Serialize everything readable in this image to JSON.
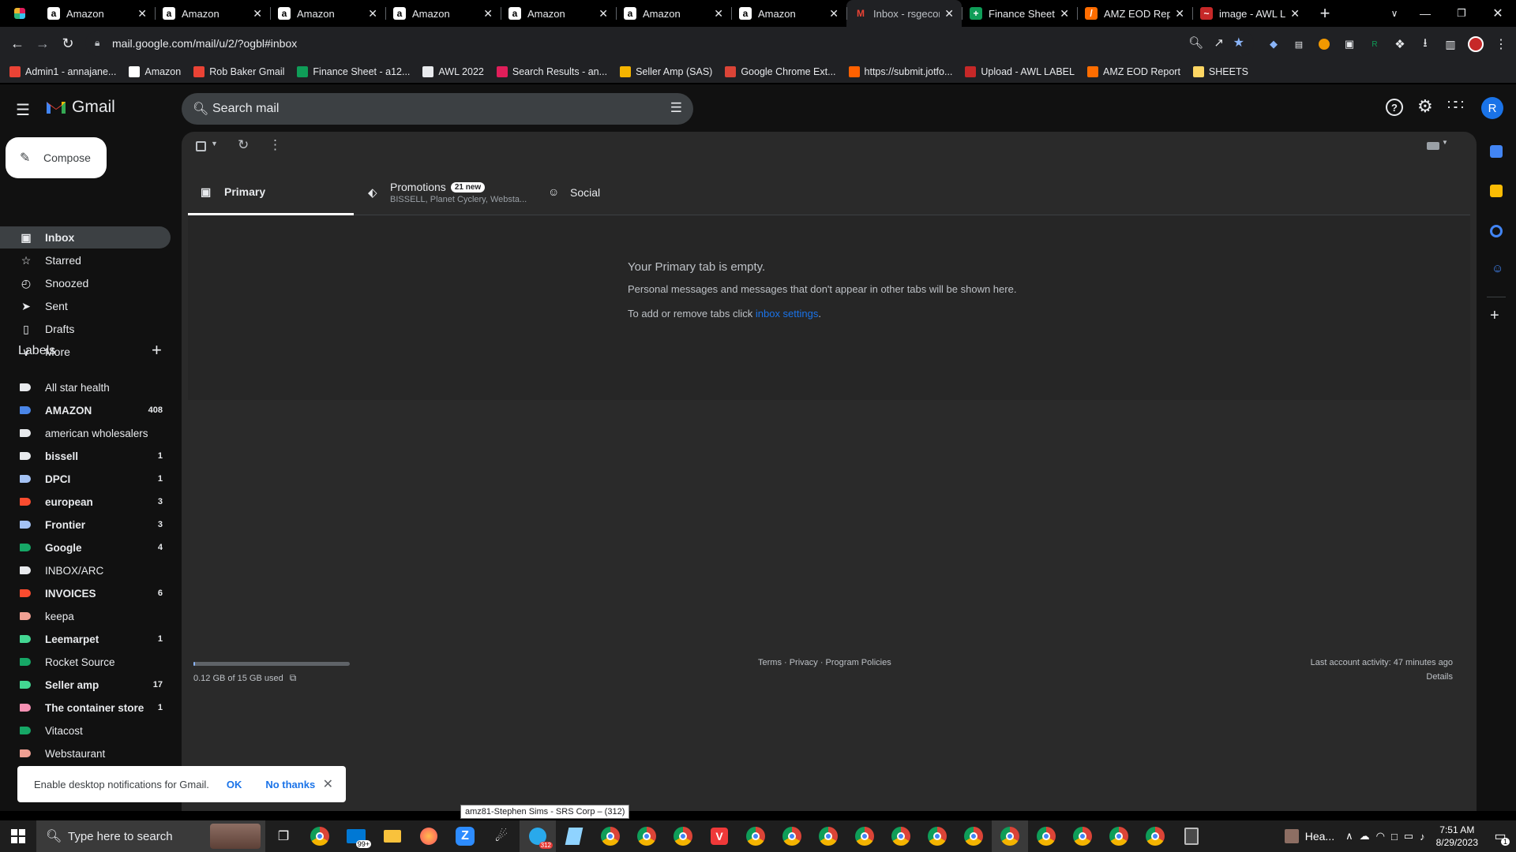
{
  "browser": {
    "tabs": [
      {
        "title": "Amazon",
        "icon": "amazon-icon"
      },
      {
        "title": "Amazon",
        "icon": "amazon-icon"
      },
      {
        "title": "Amazon",
        "icon": "amazon-icon"
      },
      {
        "title": "Amazon",
        "icon": "amazon-icon"
      },
      {
        "title": "Amazon",
        "icon": "amazon-icon"
      },
      {
        "title": "Amazon",
        "icon": "amazon-icon"
      },
      {
        "title": "Amazon",
        "icon": "amazon-icon"
      },
      {
        "title": "Inbox - rsgecor",
        "icon": "gmail-icon"
      },
      {
        "title": "Finance Sheet -",
        "icon": "sheets-icon"
      },
      {
        "title": "AMZ EOD Rep",
        "icon": "report-icon"
      },
      {
        "title": "image - AWL L",
        "icon": "image-icon"
      }
    ],
    "url": "mail.google.com/mail/u/2/?ogbl#inbox",
    "bookmarks": [
      {
        "label": "Admin1 - annajane...",
        "color": "#ea4335"
      },
      {
        "label": "Amazon",
        "color": "#ffffff"
      },
      {
        "label": "Rob Baker Gmail",
        "color": "#ea4335"
      },
      {
        "label": "Finance Sheet - a12...",
        "color": "#0f9d58"
      },
      {
        "label": "AWL 2022",
        "color": "#e8eaed"
      },
      {
        "label": "Search Results - an...",
        "color": "#e01e5a"
      },
      {
        "label": "Seller Amp (SAS)",
        "color": "#f4b400"
      },
      {
        "label": "Google Chrome Ext...",
        "color": "#db4437"
      },
      {
        "label": "https://submit.jotfo...",
        "color": "#ff6100"
      },
      {
        "label": "Upload - AWL LABEL",
        "color": "#c62828"
      },
      {
        "label": "AMZ EOD Report",
        "color": "#ff6d00"
      },
      {
        "label": "SHEETS",
        "color": "#fdd663"
      }
    ]
  },
  "gmail": {
    "brand": "Gmail",
    "search_placeholder": "Search mail",
    "avatar_letter": "R",
    "compose": "Compose",
    "nav": [
      {
        "label": "Inbox",
        "icon": "inbox-icon",
        "active": true
      },
      {
        "label": "Starred",
        "icon": "star-icon"
      },
      {
        "label": "Snoozed",
        "icon": "clock-icon"
      },
      {
        "label": "Sent",
        "icon": "send-icon"
      },
      {
        "label": "Drafts",
        "icon": "draft-icon"
      },
      {
        "label": "More",
        "icon": "chevron-down-icon"
      }
    ],
    "labels_title": "Labels",
    "labels": [
      {
        "name": "All star health",
        "color": "#e8eaed",
        "count": "",
        "bold": false
      },
      {
        "name": "AMAZON",
        "color": "#4a86e8",
        "count": "408",
        "bold": true
      },
      {
        "name": "american wholesalers",
        "color": "#e8eaed",
        "count": "",
        "bold": false
      },
      {
        "name": "bissell",
        "color": "#e8eaed",
        "count": "1",
        "bold": true
      },
      {
        "name": "DPCI",
        "color": "#a4c2f4",
        "count": "1",
        "bold": true
      },
      {
        "name": "european",
        "color": "#fb4c2f",
        "count": "3",
        "bold": true
      },
      {
        "name": "Frontier",
        "color": "#a4c2f4",
        "count": "3",
        "bold": true
      },
      {
        "name": "Google",
        "color": "#16a766",
        "count": "4",
        "bold": true
      },
      {
        "name": "INBOX/ARC",
        "color": "#e8eaed",
        "count": "",
        "bold": false
      },
      {
        "name": "INVOICES",
        "color": "#fb4c2f",
        "count": "6",
        "bold": true
      },
      {
        "name": "keepa",
        "color": "#efa093",
        "count": "",
        "bold": false
      },
      {
        "name": "Leemarpet",
        "color": "#43d692",
        "count": "1",
        "bold": true
      },
      {
        "name": "Rocket Source",
        "color": "#16a766",
        "count": "",
        "bold": false
      },
      {
        "name": "Seller amp",
        "color": "#43d692",
        "count": "17",
        "bold": true
      },
      {
        "name": "The container store",
        "color": "#f691b3",
        "count": "1",
        "bold": true
      },
      {
        "name": "Vitacost",
        "color": "#16a766",
        "count": "",
        "bold": false
      },
      {
        "name": "Webstaurant",
        "color": "#efa093",
        "count": "",
        "bold": false
      }
    ],
    "tabs": {
      "primary": "Primary",
      "promotions": "Promotions",
      "promotions_badge": "21 new",
      "promotions_sub": "BISSELL, Planet Cyclery, Websta...",
      "social": "Social"
    },
    "empty": {
      "title": "Your Primary tab is empty.",
      "desc": "Personal messages and messages that don't appear in other tabs will be shown here.",
      "settings_prefix": "To add or remove tabs click ",
      "settings_link": "inbox settings",
      "settings_suffix": "."
    },
    "footer": {
      "storage": "0.12 GB of 15 GB used",
      "storage_fraction": 0.008,
      "links": "Terms · Privacy · Program Policies",
      "activity": "Last account activity: 47 minutes ago",
      "details": "Details"
    },
    "notification": {
      "text": "Enable desktop notifications for Gmail.",
      "ok": "OK",
      "no": "No thanks"
    },
    "tooltip": "amz81-Stephen Sims - SRS Corp – (312)"
  },
  "taskbar": {
    "search_placeholder": "Type here to search",
    "mail_badge": "99+",
    "telegram_badge": "312",
    "weather": "Hea...",
    "time": "7:51 AM",
    "date": "8/29/2023",
    "notif_count": "1"
  }
}
